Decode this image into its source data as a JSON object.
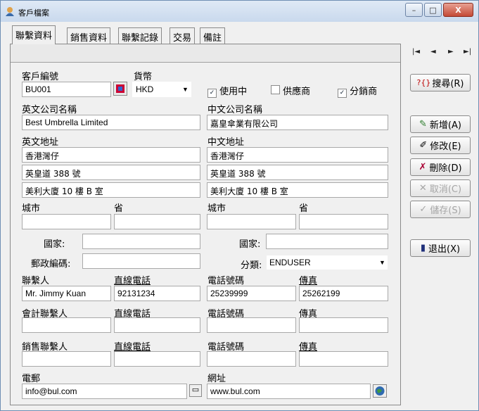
{
  "window": {
    "title": "客戶檔案",
    "min": "–",
    "max": "□",
    "close": "X"
  },
  "tabs": [
    "聯繫資料",
    "銷售資料",
    "聯繫記錄",
    "交易",
    "備註"
  ],
  "nav": [
    "|◄",
    "◄",
    "►",
    "►|"
  ],
  "labels": {
    "customer_no": "客戶編號",
    "currency": "貨幣",
    "in_use": "使用中",
    "supplier": "供應商",
    "distributor": "分銷商",
    "en_company": "英文公司名稱",
    "cn_company": "中文公司名稱",
    "en_address": "英文地址",
    "cn_address": "中文地址",
    "city": "城市",
    "province": "省",
    "country": "國家:",
    "postal": "郵政編碼:",
    "category": "分類:",
    "contact": "聯繫人",
    "direct_phone": "直線電話",
    "phone": "電話號碼",
    "fax": "傳真",
    "accounting_contact": "會計聯繫人",
    "sales_contact": "銷售聯繫人",
    "email": "電郵",
    "website": "網址"
  },
  "values": {
    "customer_no": "BU001",
    "currency": "HKD",
    "en_company": "Best Umbrella Limited",
    "cn_company": "嘉皇傘業有限公司",
    "en_addr1": "香港灣仔",
    "en_addr2": "英皇道 388 號",
    "en_addr3": "美利大廈 10 樓 B 室",
    "cn_addr1": "香港灣仔",
    "cn_addr2": "英皇道 388 號",
    "cn_addr3": "美利大廈 10 樓 B 室",
    "category": "ENDUSER",
    "contact": "Mr. Jimmy Kuan",
    "direct_phone": "92131234",
    "phone": "25239999",
    "fax": "25262199",
    "email": "info@bul.com",
    "website": "www.bul.com"
  },
  "checkboxes": {
    "in_use": true,
    "supplier": false,
    "distributor": true
  },
  "buttons": {
    "search": "搜尋(R)",
    "new": "新增(A)",
    "edit": "修改(E)",
    "delete": "刪除(D)",
    "cancel": "取消(C)",
    "save": "儲存(S)",
    "exit": "退出(X)"
  },
  "icons": {
    "search": "?{}",
    "new": "✎",
    "edit": "✐",
    "delete": "✗",
    "cancel": "✕",
    "save": "✓",
    "exit": "▮"
  }
}
